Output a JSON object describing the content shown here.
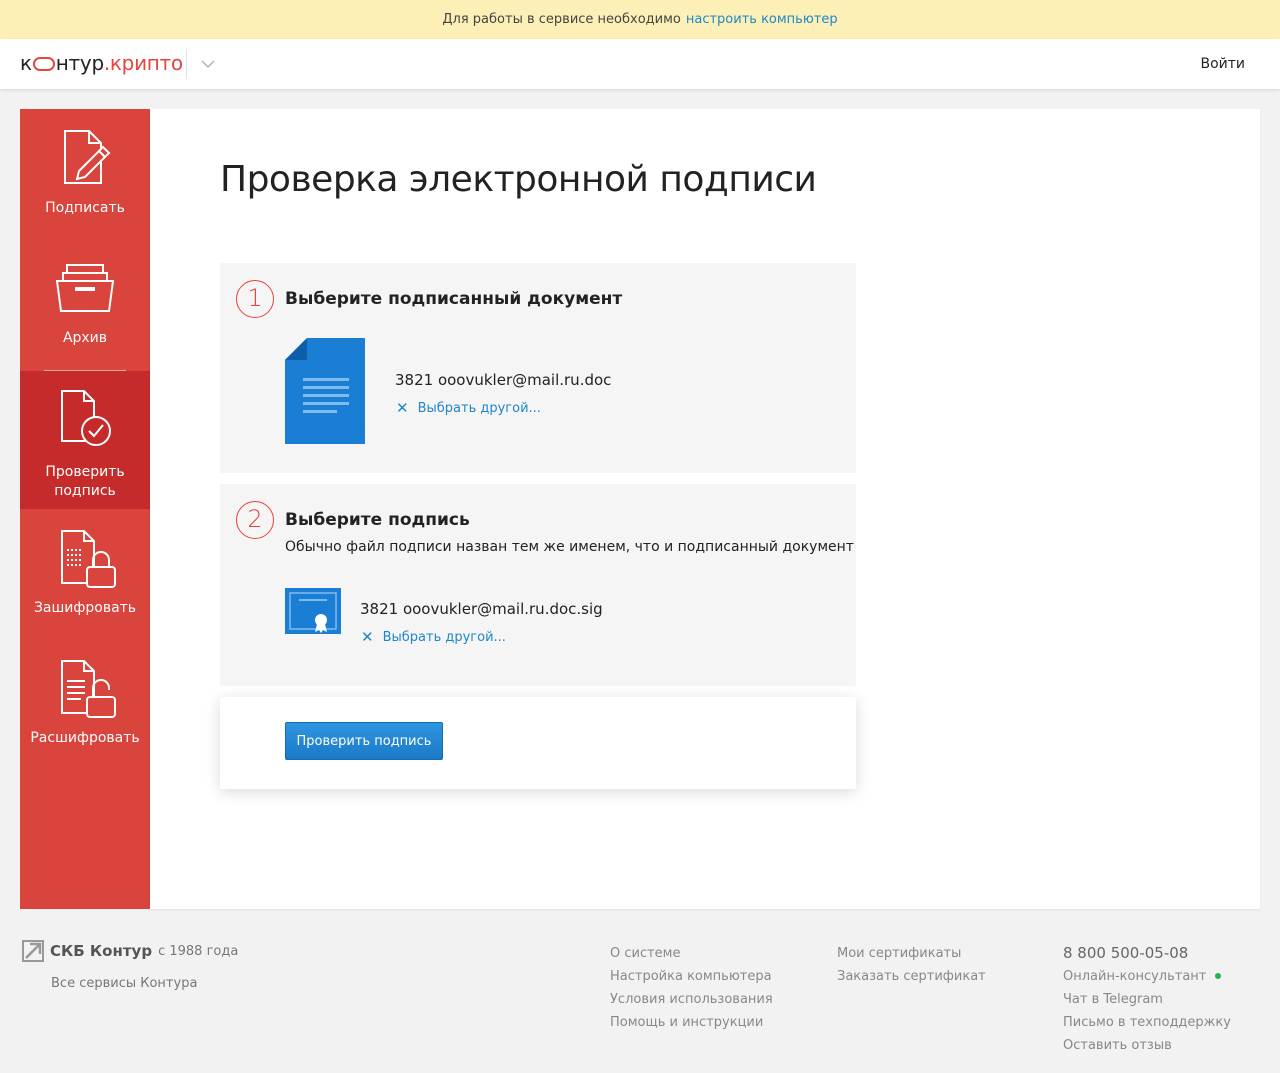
{
  "banner": {
    "text": "Для работы в сервисе необходимо",
    "link": "настроить компьютер"
  },
  "header": {
    "logo_part1": "к",
    "logo_part2": "нтур",
    "logo_part3": ".крипто",
    "login": "Войти"
  },
  "sidebar": {
    "items": [
      {
        "label": "Подписать"
      },
      {
        "label": "Архив"
      },
      {
        "label_line1": "Проверить",
        "label_line2": "подпись"
      },
      {
        "label": "Зашифровать"
      },
      {
        "label": "Расшифровать"
      }
    ]
  },
  "main": {
    "title": "Проверка электронной подписи",
    "step1": {
      "number": "1",
      "title": "Выберите подписанный документ",
      "file": "3821 ooovukler@mail.ru.doc",
      "change": "Выбрать другой..."
    },
    "step2": {
      "number": "2",
      "title": "Выберите подпись",
      "desc": "Обычно файл подписи назван тем же именем, что и подписанный документ",
      "file": "3821 ooovukler@mail.ru.doc.sig",
      "change": "Выбрать другой..."
    },
    "action": {
      "button": "Проверить подпись"
    }
  },
  "footer": {
    "brand": "СКБ Контур",
    "since": "с 1988 года",
    "all_services": "Все сервисы Контура",
    "col1": [
      "О системе",
      "Настройка компьютера",
      "Условия использования",
      "Помощь и инструкции"
    ],
    "col2": [
      "Мои сертификаты",
      "Заказать сертификат"
    ],
    "phone": "8 800 500-05-08",
    "col3": [
      "Онлайн-консультант",
      "Чат в Telegram",
      "Письмо в техподдержку",
      "Оставить отзыв"
    ]
  },
  "colors": {
    "brand_red": "#d9443d",
    "active_red": "#c42b2a",
    "link_blue": "#1f87c9",
    "button_blue": "#1b7ac7",
    "doc_blue": "#1a7fd4",
    "online_green": "#1fb74e"
  }
}
